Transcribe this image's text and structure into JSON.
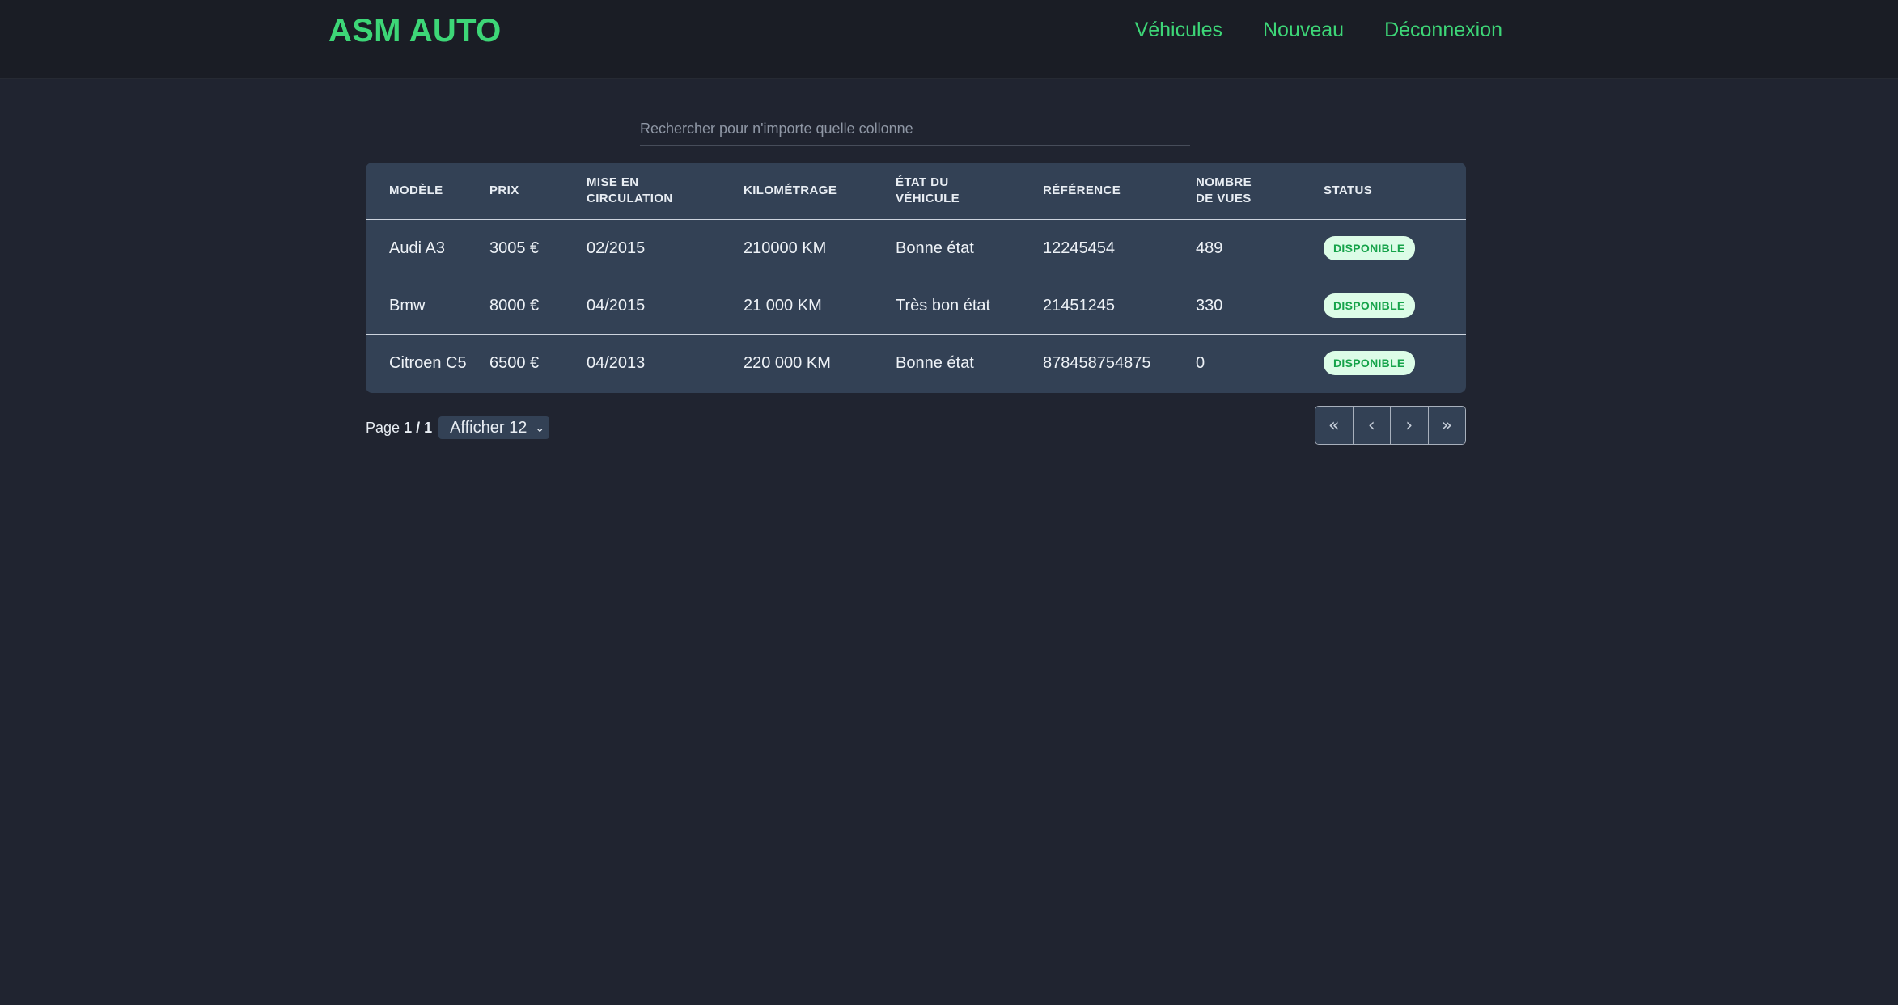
{
  "brand": "ASM AUTO",
  "nav": {
    "vehicules": "Véhicules",
    "nouveau": "Nouveau",
    "deconnexion": "Déconnexion"
  },
  "search": {
    "placeholder": "Rechercher pour n'importe quelle collonne",
    "value": ""
  },
  "table": {
    "headers": {
      "modele": "Modèle",
      "prix": "Prix",
      "mise_en_circulation_1": "Mise en",
      "mise_en_circulation_2": "circulation",
      "kilometrage": "Kilométrage",
      "etat_1": "État du",
      "etat_2": "véhicule",
      "reference": "Référence",
      "vues_1": "Nombre",
      "vues_2": "de vues",
      "status": "Status"
    },
    "rows": [
      {
        "modele": "Audi A3",
        "prix": "3005 €",
        "mise": "02/2015",
        "km": "210000 KM",
        "etat": "Bonne état",
        "reference": "12245454",
        "vues": "489",
        "status": "DISPONIBLE"
      },
      {
        "modele": "Bmw",
        "prix": "8000 €",
        "mise": "04/2015",
        "km": "21 000 KM",
        "etat": "Très bon état",
        "reference": "21451245",
        "vues": "330",
        "status": "DISPONIBLE"
      },
      {
        "modele": "Citroen C5",
        "prix": "6500 €",
        "mise": "04/2013",
        "km": "220 000 KM",
        "etat": "Bonne état",
        "reference": "878458754875",
        "vues": "0",
        "status": "DISPONIBLE"
      }
    ]
  },
  "pagination": {
    "page_label": "Page",
    "current_total": "1 / 1",
    "page_size": "Afficher 12",
    "first": "«",
    "prev": "‹",
    "next": "›",
    "last": "»"
  },
  "colors": {
    "background": "#202430",
    "topbar": "#1a1d25",
    "accent": "#3dd677",
    "table_bg": "#334155",
    "badge_bg": "#dcfce7",
    "badge_text": "#16a34a"
  },
  "icons": {
    "first": "chevrons-double-left-icon",
    "prev": "chevron-left-icon",
    "next": "chevron-right-icon",
    "last": "chevrons-double-right-icon",
    "select": "chevron-down-icon"
  }
}
